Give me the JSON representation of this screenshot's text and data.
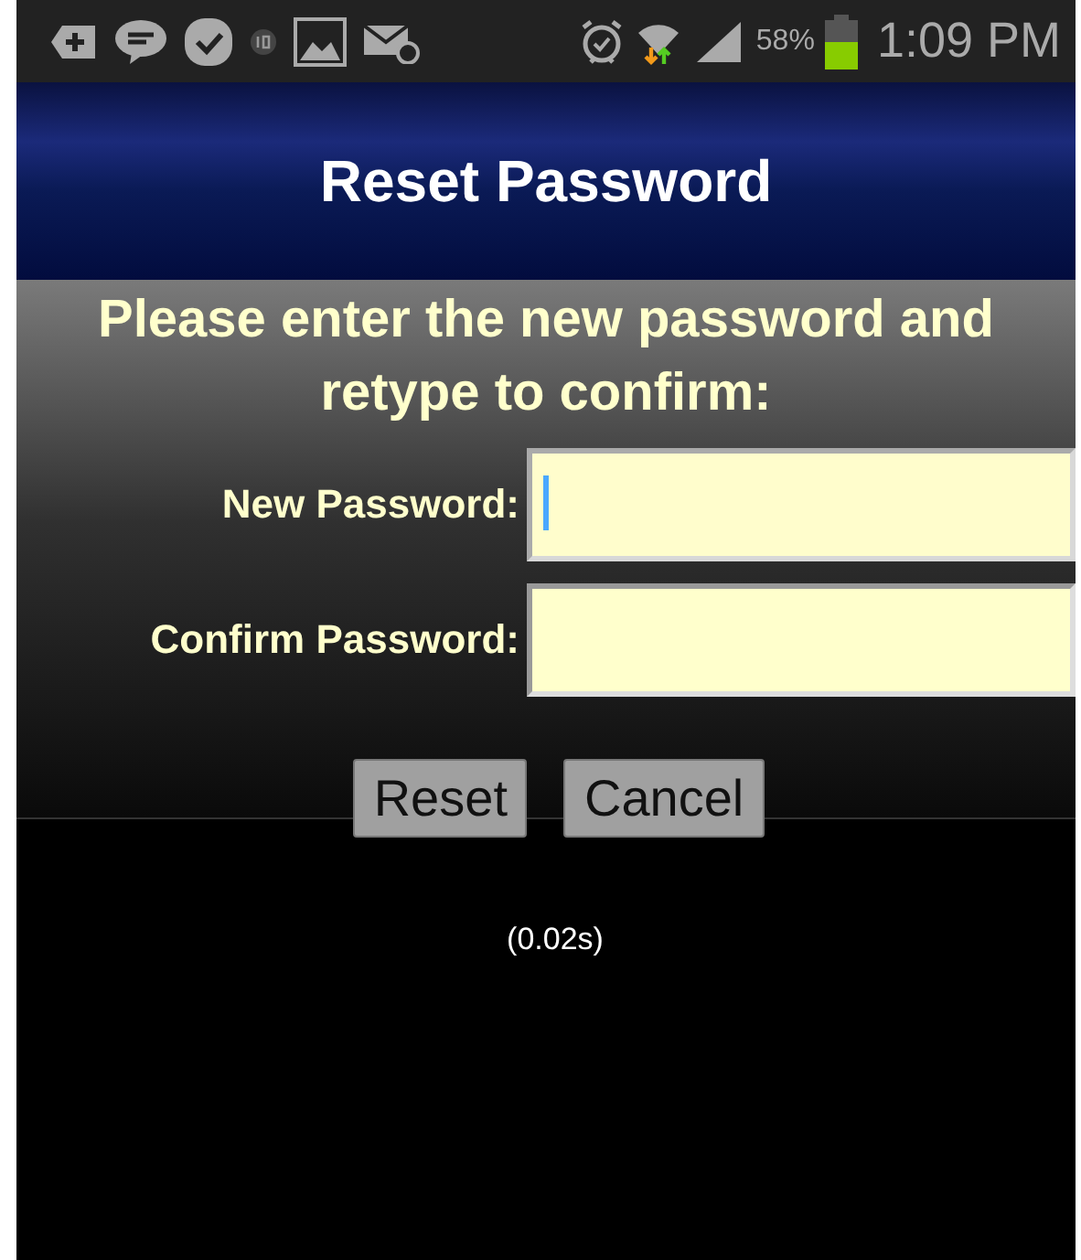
{
  "status_bar": {
    "battery_percent": "58%",
    "battery": {
      "level": 0.55
    },
    "time": "1:09 PM"
  },
  "header": {
    "title": "Reset Password"
  },
  "form": {
    "instructions": "Please enter the new password and retype to confirm:",
    "fields": [
      {
        "label": "New Password:",
        "focused": true
      },
      {
        "label": "Confirm Password:",
        "focused": false
      }
    ],
    "buttons": [
      "Reset",
      "Cancel"
    ]
  },
  "timing": "(0.02s)"
}
